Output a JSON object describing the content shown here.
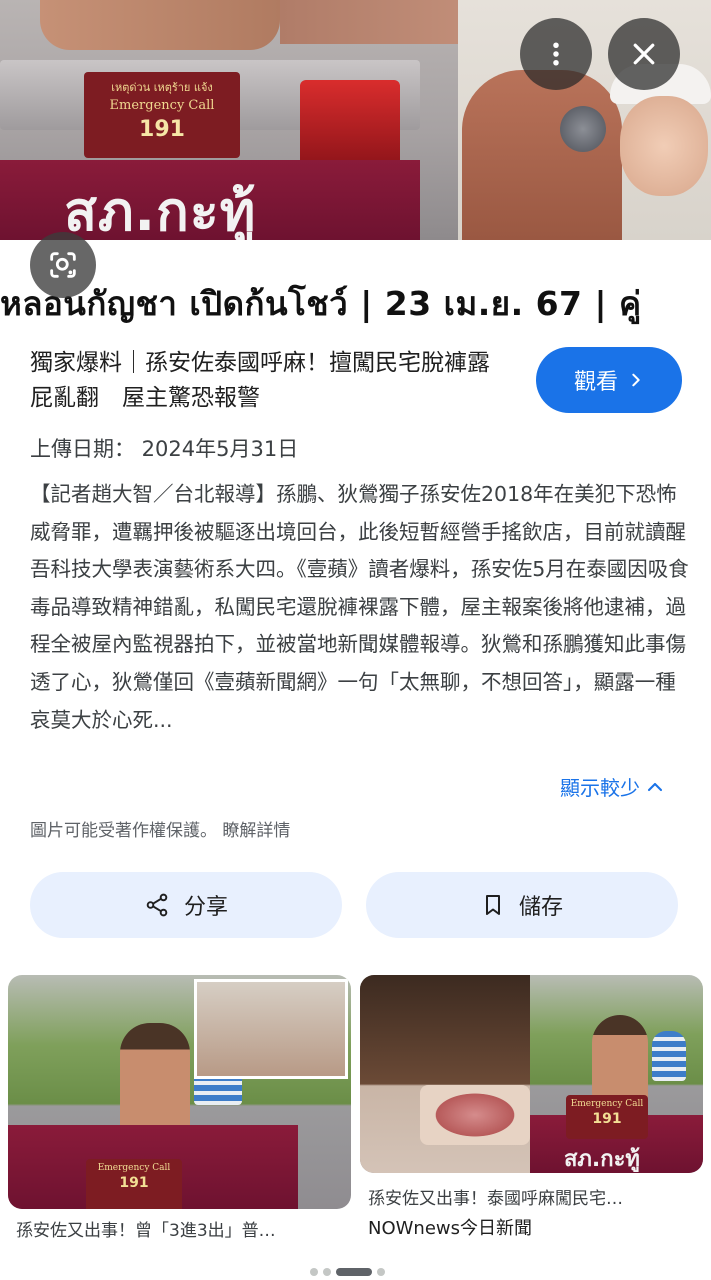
{
  "hero": {
    "plate_line1": "เหตุด่วน เหตุร้าย แจ้ง",
    "plate_line2": "Emergency Call",
    "plate_number": "191",
    "station_text": "สภ.กะทู้",
    "caption": "หลอนกัญชา เปิดก้นโชว์ | 23 เม.ย. 67 | คู่"
  },
  "article": {
    "title": "獨家爆料｜孫安佐泰國呼麻！擅闖民宅脫褲露屁亂翻　屋主驚恐報警",
    "view_label": "觀看",
    "upload_date": "上傳日期： 2024年5月31日",
    "body": "【記者趙大智／台北報導】孫鵬、狄鶯獨子孫安佐2018年在美犯下恐怖威脅罪，遭羈押後被驅逐出境回台，此後短暫經營手搖飲店，目前就讀醒吾科技大學表演藝術系大四。《壹蘋》讀者爆料，孫安佐5月在泰國因吸食毒品導致精神錯亂，私闖民宅還脫褲裸露下體，屋主報案後將他逮補，過程全被屋內監視器拍下，並被當地新聞媒體報導。狄鶯和孫鵬獲知此事傷透了心，狄鶯僅回《壹蘋新聞網》一句「太無聊，不想回答」，顯露一種哀莫大於心死...",
    "show_less": "顯示較少",
    "copyright": "圖片可能受著作權保護。 瞭解詳情"
  },
  "actions": {
    "share": "分享",
    "save": "儲存"
  },
  "related": [
    {
      "title": "孫安佐又出事！曾「3進3出」普…",
      "source": "",
      "plate_number": "191",
      "plate_line2": "Emergency Call"
    },
    {
      "title": "孫安佐又出事！泰國呼麻闖民宅…",
      "source": "NOWnews今日新聞",
      "plate_number": "191",
      "plate_line2": "Emergency Call",
      "station_text": "สภ.กะทู้"
    }
  ],
  "icons": {
    "more": "more-vert-icon",
    "close": "close-icon",
    "lens": "lens-icon",
    "chevron_right": "chevron-right-icon",
    "chevron_up": "chevron-up-icon",
    "share": "share-icon",
    "bookmark": "bookmark-icon"
  },
  "colors": {
    "accent": "#1a73e8",
    "action_bg": "#e8f0fe",
    "text_secondary": "#3c4043"
  },
  "carousel": {
    "count": 4,
    "active_index": 2
  }
}
